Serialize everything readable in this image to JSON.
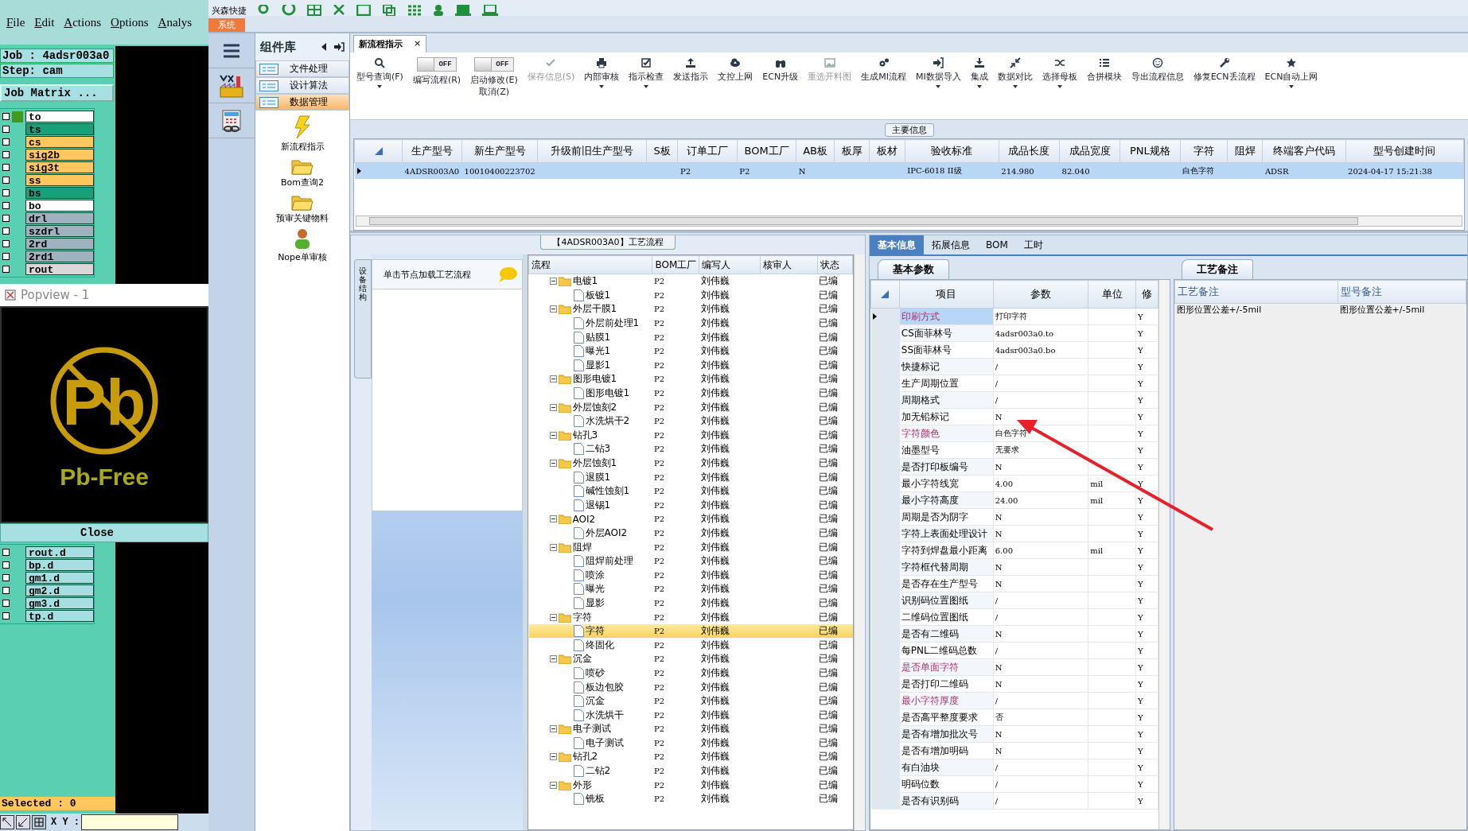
{
  "cam": {
    "menu": [
      "File",
      "Edit",
      "Actions",
      "Options",
      "Analys"
    ],
    "job": "Job : 4adsr003a0",
    "step": "Step: cam",
    "matrix_button": "Job Matrix ...",
    "layers": [
      {
        "name": "to",
        "color": "#ffffff",
        "work_layer": true,
        "checked": false
      },
      {
        "name": "ts",
        "color": "#17a07a",
        "work_layer": false,
        "checked": false
      },
      {
        "name": "cs",
        "color": "#ffc75e",
        "work_layer": false,
        "checked": false
      },
      {
        "name": "sig2b",
        "color": "#ffc75e",
        "work_layer": false,
        "checked": false
      },
      {
        "name": "sig3t",
        "color": "#ffc75e",
        "work_layer": false,
        "checked": false
      },
      {
        "name": "ss",
        "color": "#ffc75e",
        "work_layer": false,
        "checked": false
      },
      {
        "name": "bs",
        "color": "#17a07a",
        "work_layer": false,
        "checked": false
      },
      {
        "name": "bo",
        "color": "#ffffff",
        "work_layer": false,
        "checked": false
      },
      {
        "name": "drl",
        "color": "#9fb3bf",
        "work_layer": false,
        "checked": false
      },
      {
        "name": "szdrl",
        "color": "#9fb3bf",
        "work_layer": false,
        "checked": false
      },
      {
        "name": "2rd",
        "color": "#9fb3bf",
        "work_layer": false,
        "checked": false
      },
      {
        "name": "2rd1",
        "color": "#9fb3bf",
        "work_layer": false,
        "checked": false
      },
      {
        "name": "rout",
        "color": "#d8d8d8",
        "work_layer": false,
        "checked": false
      }
    ],
    "popview": {
      "title": "Popview - 1",
      "logo_symbol": "Pb",
      "logo_caption": "Pb-Free",
      "close_button": "Close"
    },
    "layers_lower": [
      {
        "name": "rout.d",
        "color": "#a6dfe2",
        "work_layer": false,
        "checked": false
      },
      {
        "name": "bp.d",
        "color": "#a6dfe2",
        "work_layer": false,
        "checked": false
      },
      {
        "name": "gm1.d",
        "color": "#a6dfe2",
        "work_layer": false,
        "checked": false
      },
      {
        "name": "gm2.d",
        "color": "#a6dfe2",
        "work_layer": false,
        "checked": false
      },
      {
        "name": "gm3.d",
        "color": "#a6dfe2",
        "work_layer": false,
        "checked": false
      },
      {
        "name": "tp.d",
        "color": "#a6dfe2",
        "work_layer": false,
        "checked": false
      }
    ],
    "selected_count": "Selected : 0",
    "coords_label": "X Y :"
  },
  "app": {
    "quick_access": "兴森快捷",
    "system_tab": "系统",
    "component_panel": {
      "title": "组件库",
      "sections": [
        {
          "label": "文件处理",
          "selected": false
        },
        {
          "label": "设计算法",
          "selected": false
        },
        {
          "label": "数据管理",
          "selected": true
        }
      ],
      "tools": [
        {
          "label": "新流程指示",
          "kind": "lightning"
        },
        {
          "label": "Bom查询2",
          "kind": "folder"
        },
        {
          "label": "预审关键物料",
          "kind": "folder"
        },
        {
          "label": "Nope单审核",
          "kind": "person"
        }
      ]
    },
    "document_tab": {
      "label": "新流程指示",
      "close": "×"
    },
    "ribbon": [
      {
        "kind": "button",
        "label": "型号查询(F)",
        "disabled": false,
        "dropdown": true
      },
      {
        "kind": "toggle",
        "label": "编写流程(R)",
        "on": false,
        "state_label": "OFF"
      },
      {
        "kind": "toggle",
        "label": "启动修改(E)\n取消(Z)",
        "on": false,
        "state_label": "OFF"
      },
      {
        "kind": "button",
        "label": "保存信息(S)",
        "disabled": true,
        "dropdown": false
      },
      {
        "kind": "button",
        "label": "内部审核",
        "disabled": false,
        "dropdown": true
      },
      {
        "kind": "button",
        "label": "指示检查",
        "disabled": false,
        "dropdown": true
      },
      {
        "kind": "button",
        "label": "发送指示",
        "disabled": false,
        "dropdown": false
      },
      {
        "kind": "button",
        "label": "文控上网",
        "disabled": false,
        "dropdown": false
      },
      {
        "kind": "button",
        "label": "ECN升级",
        "disabled": false,
        "dropdown": false
      },
      {
        "kind": "button",
        "label": "重选开料图",
        "disabled": true,
        "dropdown": false
      },
      {
        "kind": "button",
        "label": "生成MI流程",
        "disabled": false,
        "dropdown": false
      },
      {
        "kind": "button",
        "label": "MI数据导入",
        "disabled": false,
        "dropdown": true
      },
      {
        "kind": "button",
        "label": "集成",
        "disabled": false,
        "dropdown": true
      },
      {
        "kind": "button",
        "label": "数据对比",
        "disabled": false,
        "dropdown": true
      },
      {
        "kind": "button",
        "label": "选择母板",
        "disabled": false,
        "dropdown": true
      },
      {
        "kind": "button",
        "label": "合拼模块",
        "disabled": false,
        "dropdown": false
      },
      {
        "kind": "button",
        "label": "导出流程信息",
        "disabled": false,
        "dropdown": false
      },
      {
        "kind": "button",
        "label": "修复ECN丢流程",
        "disabled": false,
        "dropdown": false
      },
      {
        "kind": "button",
        "label": "ECN自动上网",
        "disabled": false,
        "dropdown": true
      }
    ],
    "main_info": {
      "title": "主要信息",
      "columns": [
        "生产型号",
        "新生产型号",
        "升级前旧生产型号",
        "S板",
        "订单工厂",
        "BOM工厂",
        "AB板",
        "板厚",
        "板材",
        "验收标准",
        "成品长度",
        "成品宽度",
        "PNL规格",
        "字符",
        "阻焊",
        "终端客户代码",
        "型号创建时间"
      ],
      "rows": [
        {
          "selected": true,
          "cells": [
            "4ADSR003A0",
            "10010400223702",
            null,
            null,
            "P2",
            "P2",
            "N",
            null,
            null,
            "IPC-6018 II级",
            "214.980",
            "82.040",
            null,
            "白色字符",
            null,
            "ADSR",
            "2024-04-17 15:21:38"
          ]
        }
      ]
    },
    "flow": {
      "title": "【4ADSR003A0】工艺流程",
      "side_tab": "设备结构",
      "hint": "单击节点加载工艺流程",
      "columns": [
        "流程",
        "BOM工厂",
        "编写人",
        "核审人",
        "状态"
      ],
      "nodes": [
        {
          "name": "电镀1",
          "bom_factory": "P2",
          "author": "刘伟巍",
          "status": "已编",
          "expanded": true,
          "selected": false,
          "children": [
            {
              "name": "板镀1",
              "bom_factory": "P2",
              "author": "刘伟巍",
              "status": "已编",
              "selected": false
            }
          ]
        },
        {
          "name": "外层干膜1",
          "bom_factory": "P2",
          "author": "刘伟巍",
          "status": "已编",
          "expanded": true,
          "selected": false,
          "children": [
            {
              "name": "外层前处理1",
              "bom_factory": "P2",
              "author": "刘伟巍",
              "status": "已编",
              "selected": false
            },
            {
              "name": "贴膜1",
              "bom_factory": "P2",
              "author": "刘伟巍",
              "status": "已编",
              "selected": false
            },
            {
              "name": "曝光1",
              "bom_factory": "P2",
              "author": "刘伟巍",
              "status": "已编",
              "selected": false
            },
            {
              "name": "显影1",
              "bom_factory": "P2",
              "author": "刘伟巍",
              "status": "已编",
              "selected": false
            }
          ]
        },
        {
          "name": "图形电镀1",
          "bom_factory": "P2",
          "author": "刘伟巍",
          "status": "已编",
          "expanded": true,
          "selected": false,
          "children": [
            {
              "name": "图形电镀1",
              "bom_factory": "P2",
              "author": "刘伟巍",
              "status": "已编",
              "selected": false
            }
          ]
        },
        {
          "name": "外层蚀刻2",
          "bom_factory": "P2",
          "author": "刘伟巍",
          "status": "已编",
          "expanded": true,
          "selected": false,
          "children": [
            {
              "name": "水洗烘干2",
              "bom_factory": "P2",
              "author": "刘伟巍",
              "status": "已编",
              "selected": false
            }
          ]
        },
        {
          "name": "钻孔3",
          "bom_factory": "P2",
          "author": "刘伟巍",
          "status": "已编",
          "expanded": true,
          "selected": false,
          "children": [
            {
              "name": "二钻3",
              "bom_factory": "P2",
              "author": "刘伟巍",
              "status": "已编",
              "selected": false
            }
          ]
        },
        {
          "name": "外层蚀刻1",
          "bom_factory": "P2",
          "author": "刘伟巍",
          "status": "已编",
          "expanded": true,
          "selected": false,
          "children": [
            {
              "name": "退膜1",
              "bom_factory": "P2",
              "author": "刘伟巍",
              "status": "已编",
              "selected": false
            },
            {
              "name": "碱性蚀刻1",
              "bom_factory": "P2",
              "author": "刘伟巍",
              "status": "已编",
              "selected": false
            },
            {
              "name": "退锡1",
              "bom_factory": "P2",
              "author": "刘伟巍",
              "status": "已编",
              "selected": false
            }
          ]
        },
        {
          "name": "AOI2",
          "bom_factory": "P2",
          "author": "刘伟巍",
          "status": "已编",
          "expanded": true,
          "selected": false,
          "children": [
            {
              "name": "外层AOI2",
              "bom_factory": "P2",
              "author": "刘伟巍",
              "status": "已编",
              "selected": false
            }
          ]
        },
        {
          "name": "阻焊",
          "bom_factory": "P2",
          "author": "刘伟巍",
          "status": "已编",
          "expanded": true,
          "selected": false,
          "children": [
            {
              "name": "阻焊前处理",
              "bom_factory": "P2",
              "author": "刘伟巍",
              "status": "已编",
              "selected": false
            },
            {
              "name": "喷涂",
              "bom_factory": "P2",
              "author": "刘伟巍",
              "status": "已编",
              "selected": false
            },
            {
              "name": "曝光",
              "bom_factory": "P2",
              "author": "刘伟巍",
              "status": "已编",
              "selected": false
            },
            {
              "name": "显影",
              "bom_factory": "P2",
              "author": "刘伟巍",
              "status": "已编",
              "selected": false
            }
          ]
        },
        {
          "name": "字符",
          "bom_factory": "P2",
          "author": "刘伟巍",
          "status": "已编",
          "expanded": true,
          "selected": false,
          "children": [
            {
              "name": "字符",
              "bom_factory": "P2",
              "author": "刘伟巍",
              "status": "已编",
              "selected": true
            },
            {
              "name": "终固化",
              "bom_factory": "P2",
              "author": "刘伟巍",
              "status": "已编",
              "selected": false
            }
          ]
        },
        {
          "name": "沉金",
          "bom_factory": "P2",
          "author": "刘伟巍",
          "status": "已编",
          "expanded": true,
          "selected": false,
          "children": [
            {
              "name": "喷砂",
              "bom_factory": "P2",
              "author": "刘伟巍",
              "status": "已编",
              "selected": false
            },
            {
              "name": "板边包胶",
              "bom_factory": "P2",
              "author": "刘伟巍",
              "status": "已编",
              "selected": false
            },
            {
              "name": "沉金",
              "bom_factory": "P2",
              "author": "刘伟巍",
              "status": "已编",
              "selected": false
            },
            {
              "name": "水洗烘干",
              "bom_factory": "P2",
              "author": "刘伟巍",
              "status": "已编",
              "selected": false
            }
          ]
        },
        {
          "name": "电子测试",
          "bom_factory": "P2",
          "author": "刘伟巍",
          "status": "已编",
          "expanded": true,
          "selected": false,
          "children": [
            {
              "name": "电子测试",
              "bom_factory": "P2",
              "author": "刘伟巍",
              "status": "已编",
              "selected": false
            }
          ]
        },
        {
          "name": "钻孔2",
          "bom_factory": "P2",
          "author": "刘伟巍",
          "status": "已编",
          "expanded": true,
          "selected": false,
          "children": [
            {
              "name": "二钻2",
              "bom_factory": "P2",
              "author": "刘伟巍",
              "status": "已编",
              "selected": false
            }
          ]
        },
        {
          "name": "外形",
          "bom_factory": "P2",
          "author": "刘伟巍",
          "status": "已编",
          "expanded": true,
          "selected": false,
          "children": [
            {
              "name": "铣板",
              "bom_factory": "P2",
              "author": "刘伟巍",
              "status": "已编",
              "selected": false
            }
          ]
        }
      ]
    },
    "detail_tabs": [
      {
        "label": "基本信息",
        "selected": true
      },
      {
        "label": "拓展信息",
        "selected": false
      },
      {
        "label": "BOM",
        "selected": false
      },
      {
        "label": "工时",
        "selected": false
      }
    ],
    "params": {
      "title": "基本参数",
      "columns": [
        "项目",
        "参数",
        "单位",
        "修"
      ],
      "rows": [
        {
          "item": "印刷方式",
          "value": "打印字符",
          "modifiable": "Y",
          "flagged": true,
          "selected": true
        },
        {
          "item": "CS面菲林号",
          "value": "4adsr003a0.to",
          "modifiable": "Y",
          "flagged": false,
          "selected": false
        },
        {
          "item": "SS面菲林号",
          "value": "4adsr003a0.bo",
          "modifiable": "Y",
          "flagged": false,
          "selected": false
        },
        {
          "item": "快捷标记",
          "value": "/",
          "modifiable": "Y",
          "flagged": false,
          "selected": false
        },
        {
          "item": "生产周期位置",
          "value": "/",
          "modifiable": "Y",
          "flagged": false,
          "selected": false
        },
        {
          "item": "周期格式",
          "value": "/",
          "modifiable": "Y",
          "flagged": false,
          "selected": false
        },
        {
          "item": "加无铅标记",
          "value": "N",
          "modifiable": "Y",
          "flagged": false,
          "selected": false
        },
        {
          "item": "字符颜色",
          "value": "白色字符",
          "modifiable": "Y",
          "flagged": true,
          "selected": false
        },
        {
          "item": "油墨型号",
          "value": "无要求",
          "modifiable": "Y",
          "flagged": false,
          "selected": false
        },
        {
          "item": "是否打印板编号",
          "value": "N",
          "modifiable": "Y",
          "flagged": false,
          "selected": false
        },
        {
          "item": "最小字符线宽",
          "value": "4.00",
          "unit": "mil",
          "modifiable": "Y",
          "flagged": false,
          "selected": false
        },
        {
          "item": "最小字符高度",
          "value": "24.00",
          "unit": "mil",
          "modifiable": "Y",
          "flagged": false,
          "selected": false
        },
        {
          "item": "周期是否为阴字",
          "value": "N",
          "modifiable": "Y",
          "flagged": false,
          "selected": false
        },
        {
          "item": "字符上表面处理设计",
          "value": "N",
          "modifiable": "Y",
          "flagged": false,
          "selected": false
        },
        {
          "item": "字符到焊盘最小距离",
          "value": "6.00",
          "unit": "mil",
          "modifiable": "Y",
          "flagged": false,
          "selected": false
        },
        {
          "item": "字符框代替周期",
          "value": "N",
          "modifiable": "Y",
          "flagged": false,
          "selected": false
        },
        {
          "item": "是否存在生产型号",
          "value": "N",
          "modifiable": "Y",
          "flagged": false,
          "selected": false
        },
        {
          "item": "识别码位置图纸",
          "value": "/",
          "modifiable": "Y",
          "flagged": false,
          "selected": false
        },
        {
          "item": "二维码位置图纸",
          "value": "/",
          "modifiable": "Y",
          "flagged": false,
          "selected": false
        },
        {
          "item": "是否有二维码",
          "value": "N",
          "modifiable": "Y",
          "flagged": false,
          "selected": false
        },
        {
          "item": "每PNL二维码总数",
          "value": "/",
          "modifiable": "Y",
          "flagged": false,
          "selected": false
        },
        {
          "item": "是否单面字符",
          "value": "N",
          "modifiable": "Y",
          "flagged": true,
          "selected": false
        },
        {
          "item": "是否打印二维码",
          "value": "N",
          "modifiable": "Y",
          "flagged": false,
          "selected": false
        },
        {
          "item": "最小字符厚度",
          "value": "/",
          "modifiable": "Y",
          "flagged": true,
          "selected": false
        },
        {
          "item": "是否高平整度要求",
          "value": "否",
          "modifiable": "Y",
          "flagged": false,
          "selected": false
        },
        {
          "item": "是否有增加批次号",
          "value": "N",
          "modifiable": "Y",
          "flagged": false,
          "selected": false
        },
        {
          "item": "是否有增加明码",
          "value": "N",
          "modifiable": "Y",
          "flagged": false,
          "selected": false
        },
        {
          "item": "有白油块",
          "value": "/",
          "modifiable": "Y",
          "flagged": false,
          "selected": false
        },
        {
          "item": "明码位数",
          "value": "/",
          "modifiable": "Y",
          "flagged": false,
          "selected": false
        },
        {
          "item": "是否有识别码",
          "value": "/",
          "modifiable": "Y",
          "flagged": false,
          "selected": false
        }
      ]
    },
    "remarks": {
      "title": "工艺备注",
      "columns": [
        "工艺备注",
        "型号备注"
      ],
      "rows": [
        [
          "图形位置公差+/-5mil",
          "图形位置公差+/-5mil"
        ]
      ]
    }
  }
}
